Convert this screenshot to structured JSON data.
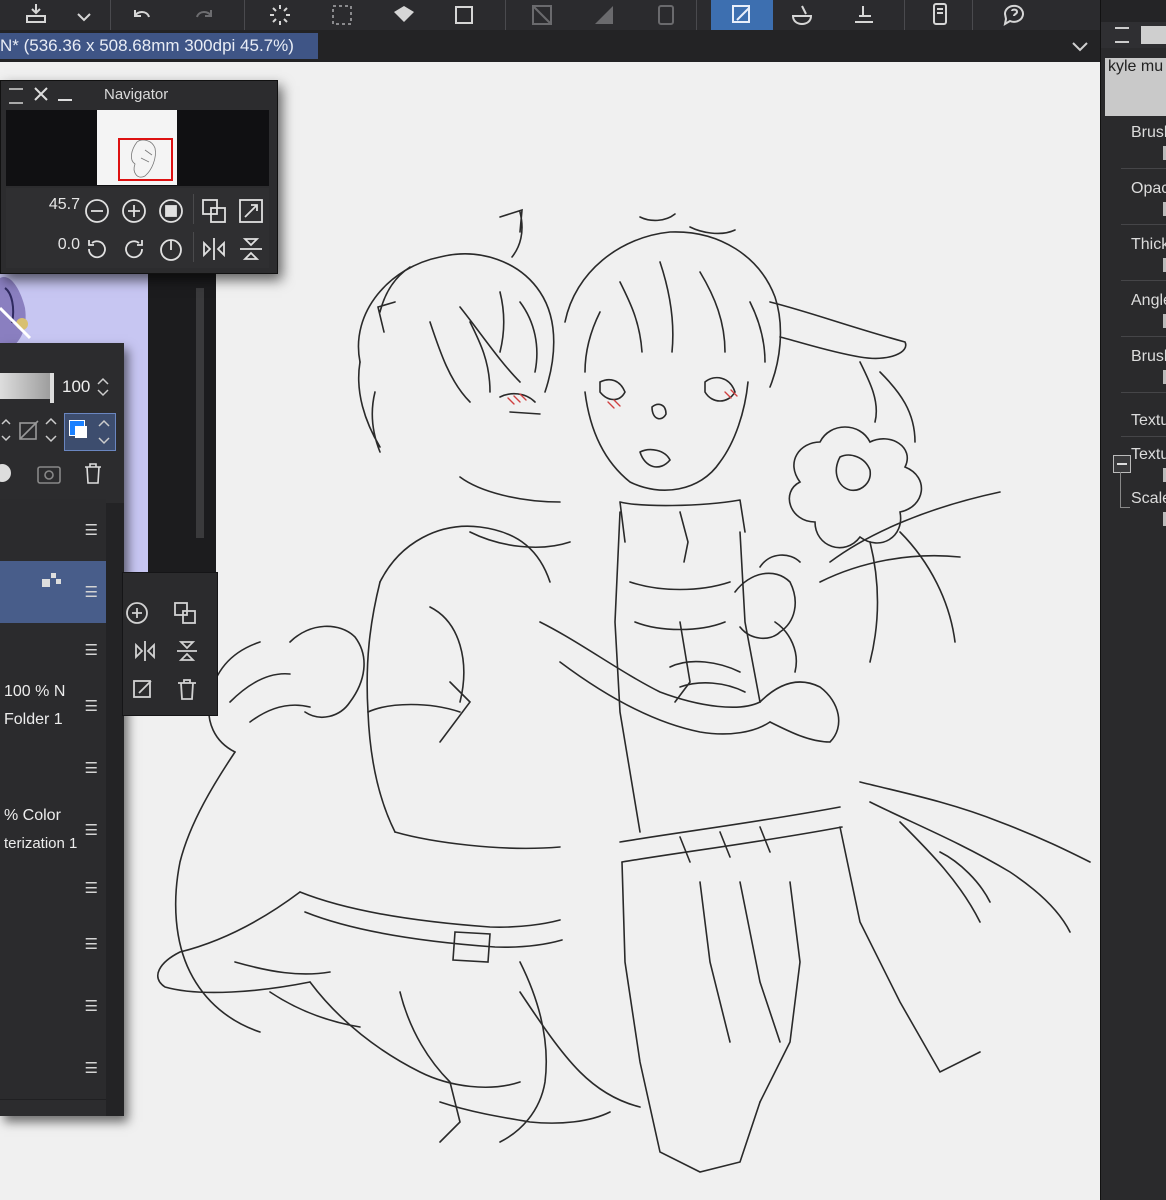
{
  "window": {
    "document_title": "N* (536.36 x 508.68mm 300dpi 45.7%)"
  },
  "toolbar": {
    "icons": [
      "export-icon",
      "chevron-down-icon",
      "undo-icon",
      "redo-icon",
      "loading-icon",
      "select-icon",
      "fill-icon",
      "transform-icon",
      "ruler-off-icon",
      "gradient-icon",
      "frame-icon",
      "pen-active-icon",
      "bucket-icon",
      "reference-icon",
      "phone-icon",
      "help-icon"
    ],
    "accent": "#3d6fb0"
  },
  "navigator": {
    "title": "Navigator",
    "zoom": "45.7",
    "rotation": "0.0",
    "frame_color": "#dd1111"
  },
  "layers": {
    "opacity_value": "100",
    "rows": [
      {
        "line1": "",
        "line2": ""
      },
      {
        "line1": "",
        "line2": "",
        "selected": true
      },
      {
        "line1": "",
        "line2": ""
      },
      {
        "line1": "100 % N",
        "line2": "Folder 1"
      },
      {
        "line1": "",
        "line2": ""
      },
      {
        "line1": "% Color",
        "line2": "terization 1"
      },
      {
        "line1": "",
        "line2": ""
      },
      {
        "line1": "",
        "line2": ""
      },
      {
        "line1": "",
        "line2": ""
      },
      {
        "line1": "",
        "line2": ""
      }
    ],
    "selected_color": "#485d8a"
  },
  "sub_tool_panel": {
    "preset_name": "kyle mu",
    "labels": [
      "Brusl",
      "Opac",
      "Thick",
      "Angle",
      "Brusl",
      "Textu",
      "Textu",
      "Scale"
    ]
  }
}
